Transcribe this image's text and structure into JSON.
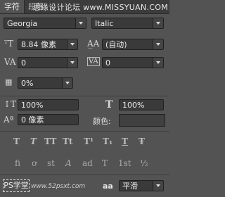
{
  "tabs": [
    {
      "label": "字符",
      "active": true
    },
    {
      "label": "段落",
      "active": false
    }
  ],
  "watermark": "思缘设计论坛 www.MISSYUAN.COM",
  "font": {
    "family": "Georgia",
    "style": "Italic"
  },
  "size": {
    "value": "8.84 像素",
    "icon": "font-size-icon"
  },
  "leading": {
    "value": "(自动)",
    "icon": "leading-icon"
  },
  "kerning": {
    "value": "0",
    "icon": "kerning-icon"
  },
  "tracking": {
    "value": "0",
    "icon": "tracking-icon"
  },
  "proportional_spacing": {
    "value": "0%",
    "icon": "tsume-icon"
  },
  "vertical_scale": {
    "value": "100%"
  },
  "horizontal_scale": {
    "value": "100%"
  },
  "baseline_shift": {
    "value": "0 像素"
  },
  "color": {
    "label": "颜色:",
    "swatch": "#404040"
  },
  "type_style_buttons": [
    "T",
    "T",
    "TT",
    "Tt",
    "T¹",
    "T₁",
    "T",
    "Ŧ"
  ],
  "opentype_buttons": [
    "fi",
    "ơ",
    "st",
    "A",
    "ad",
    "T",
    "1st",
    "½"
  ],
  "bottom": {
    "language_badge": "PS学堂",
    "site_text": "www.52psxt.com",
    "aa_label": "aa",
    "aa_method": "平滑"
  },
  "colors": {
    "panel": "#535353",
    "field": "#3a3a3a",
    "text": "#e6e6e6"
  }
}
